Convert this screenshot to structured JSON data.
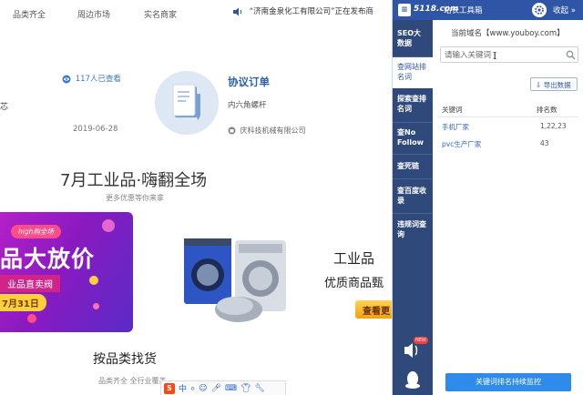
{
  "top_nav": {
    "items": [
      "品类齐全",
      "周边市场",
      "实名商家"
    ],
    "announcement": "“济南金泉化工有限公司”正在发布商"
  },
  "stray_left_char": "芯",
  "order_card": {
    "views": "117人已查看",
    "date": "2019-06-28",
    "title": "协议订单",
    "product": "内六角螺杆",
    "company": "庆科技机械有限公司"
  },
  "promo": {
    "title": "7月工业品·嗨翻全场",
    "subtitle": "更多优惠等你来拿"
  },
  "banner": {
    "tag": "high购全场",
    "headline": "品大放价",
    "line2": "业品直卖阀",
    "date": "7月31日"
  },
  "industrial": {
    "title": "工业品",
    "subtitle": "优质商品甄",
    "button": "查看更"
  },
  "category": {
    "title": "按品类找货",
    "subtitle": "品类齐全 全行业覆盖"
  },
  "ime_bar": {
    "logo": "S",
    "mode": "中"
  },
  "panel": {
    "brand": "5118.com",
    "tool_name": "站长工具箱",
    "collapse_label": "收起",
    "nav_tabs": [
      {
        "label": "SEO大数据"
      },
      {
        "label": "查网站排名词"
      },
      {
        "label": "探索查排名词"
      },
      {
        "label": "查No Follow"
      },
      {
        "label": "查死链"
      },
      {
        "label": "查百度收录"
      },
      {
        "label": "违规词查询"
      }
    ],
    "new_badge": "NEW",
    "domain_label": "当前域名【www.youboy.com】",
    "search_placeholder": "请输入关键词",
    "export_label": "导出数据",
    "table_headers": {
      "keyword": "关键词",
      "rank": "排名数"
    },
    "rows": [
      {
        "keyword": "手机厂家",
        "rank": "1,22,23"
      },
      {
        "keyword": "pvc生产厂家",
        "rank": "43"
      }
    ],
    "monitor_label": "关键词排名持续监控",
    "colors": {
      "header": "#2f56a6",
      "nav": "#2f4a7a",
      "link": "#2f66c4",
      "button": "#2f8bea"
    }
  }
}
